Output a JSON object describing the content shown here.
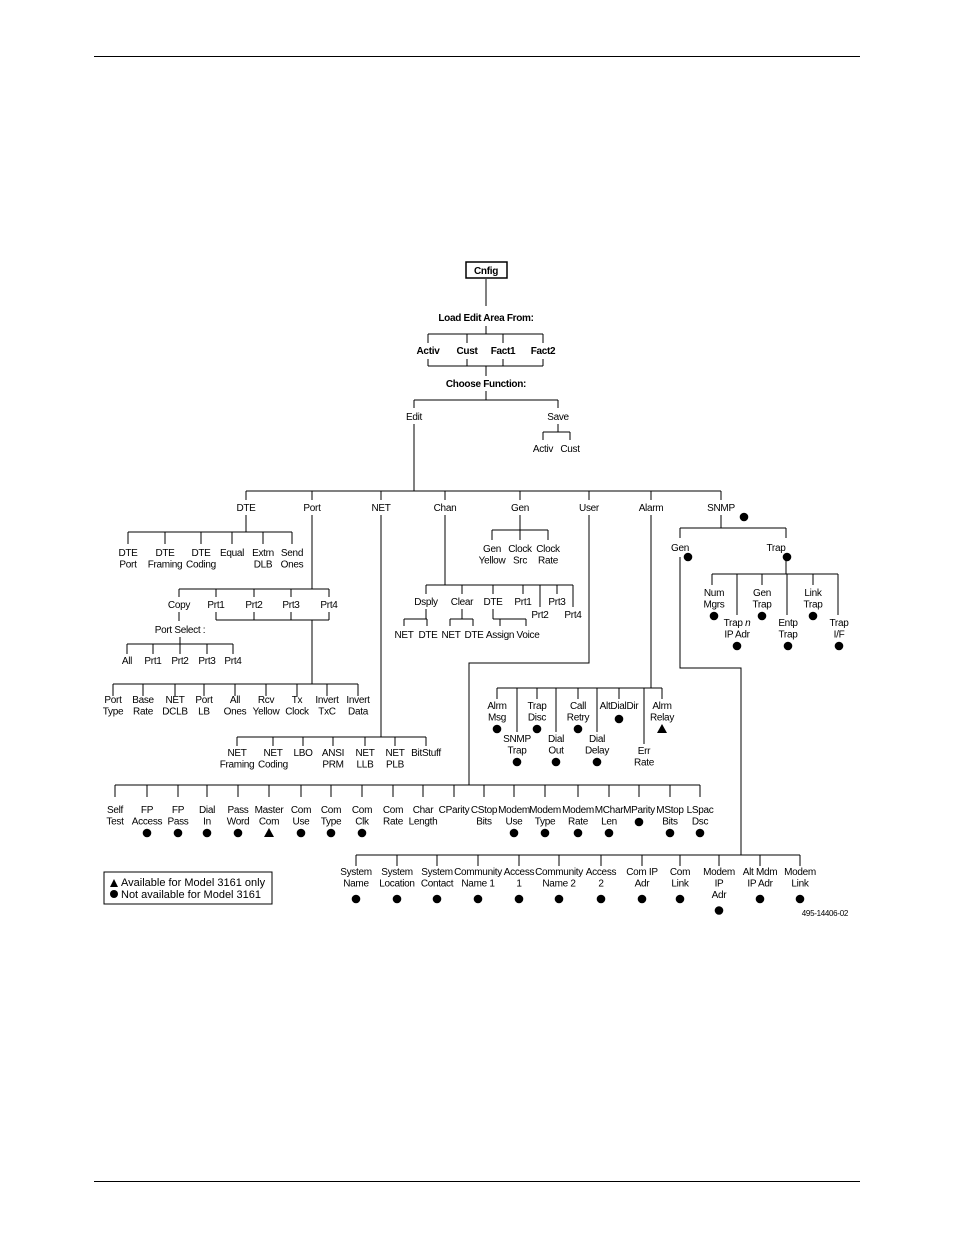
{
  "page": {
    "figure_id": "495-14406-02"
  },
  "legend": {
    "triangle": "Available for Model 3161 only",
    "circle": "Not available for Model 3161"
  },
  "tree": {
    "root": "Cnfig",
    "load_heading": "Load Edit Area From:",
    "load_options": [
      "Activ",
      "Cust",
      "Fact1",
      "Fact2"
    ],
    "function_heading": "Choose Function:",
    "functions": [
      "Edit",
      "Save"
    ],
    "save_options": [
      "Activ",
      "Cust"
    ],
    "edit_menu": [
      "DTE",
      "Port",
      "NET",
      "Chan",
      "Gen",
      "User",
      "Alarm",
      "SNMP"
    ],
    "dte": [
      [
        "DTE",
        "Port"
      ],
      [
        "DTE",
        "Framing"
      ],
      [
        "DTE",
        "Coding"
      ],
      [
        "Equal"
      ],
      [
        "Extrn",
        "DLB"
      ],
      [
        "Send",
        "Ones"
      ]
    ],
    "port_select_top": [
      "Copy",
      "Prt1",
      "Prt2",
      "Prt3",
      "Prt4"
    ],
    "port_select_heading": "Port Select :",
    "port_copy_options": [
      "All",
      "Prt1",
      "Prt2",
      "Prt3",
      "Prt4"
    ],
    "port_params": [
      [
        "Port",
        "Type"
      ],
      [
        "Base",
        "Rate"
      ],
      [
        "NET",
        "DCLB"
      ],
      [
        "Port",
        "LB"
      ],
      [
        "All",
        "Ones"
      ],
      [
        "Rcv",
        "Yellow"
      ],
      [
        "Tx",
        "Clock"
      ],
      [
        "Invert",
        "TxC"
      ],
      [
        "Invert",
        "Data"
      ]
    ],
    "net": [
      [
        "NET",
        "Framing"
      ],
      [
        "NET",
        "Coding"
      ],
      [
        "LBO"
      ],
      [
        "ANSI",
        "PRM"
      ],
      [
        "NET",
        "LLB"
      ],
      [
        "NET",
        "PLB"
      ],
      [
        "BitStuff"
      ]
    ],
    "chan": [
      "Dsply",
      "Clear",
      "DTE",
      "Prt1",
      "Prt2",
      "Prt3",
      "Prt4"
    ],
    "chan_dsply": [
      "NET",
      "DTE"
    ],
    "chan_clear": [
      "NET",
      "DTE"
    ],
    "chan_dte": [
      "Assign",
      "Voice"
    ],
    "gen": [
      [
        "Gen",
        "Yellow"
      ],
      [
        "Clock",
        "Src"
      ],
      [
        "Clock",
        "Rate"
      ]
    ],
    "user": [
      {
        "label": [
          "Self",
          "Test"
        ],
        "mark": ""
      },
      {
        "label": [
          "FP",
          "Access"
        ],
        "mark": "circle"
      },
      {
        "label": [
          "FP",
          "Pass"
        ],
        "mark": "circle"
      },
      {
        "label": [
          "Dial",
          "In"
        ],
        "mark": "circle"
      },
      {
        "label": [
          "Pass",
          "Word"
        ],
        "mark": "circle"
      },
      {
        "label": [
          "Master",
          "Com"
        ],
        "mark": "triangle"
      },
      {
        "label": [
          "Com",
          "Use"
        ],
        "mark": "circle"
      },
      {
        "label": [
          "Com",
          "Type"
        ],
        "mark": "circle"
      },
      {
        "label": [
          "Com",
          "Clk"
        ],
        "mark": "circle"
      },
      {
        "label": [
          "Com",
          "Rate"
        ],
        "mark": ""
      },
      {
        "label": [
          "Char",
          "Length"
        ],
        "mark": ""
      },
      {
        "label": [
          "CParity"
        ],
        "mark": ""
      },
      {
        "label": [
          "CStop",
          "Bits"
        ],
        "mark": ""
      },
      {
        "label": [
          "Modem",
          "Use"
        ],
        "mark": "circle"
      },
      {
        "label": [
          "Modem",
          "Type"
        ],
        "mark": "circle"
      },
      {
        "label": [
          "Modem",
          "Rate"
        ],
        "mark": "circle"
      },
      {
        "label": [
          "MChar",
          "Len"
        ],
        "mark": "circle"
      },
      {
        "label": [
          "MParity"
        ],
        "mark": "circle"
      },
      {
        "label": [
          "MStop",
          "Bits"
        ],
        "mark": "circle"
      },
      {
        "label": [
          "LSpac",
          "Dsc"
        ],
        "mark": "circle"
      }
    ],
    "alarm": [
      {
        "label": [
          "Alrm",
          "Msg"
        ],
        "mark": "circle"
      },
      {
        "label": [
          "SNMP",
          "Trap"
        ],
        "mark": "circle"
      },
      {
        "label": [
          "Trap",
          "Disc"
        ],
        "mark": "circle"
      },
      {
        "label": [
          "Dial",
          "Out"
        ],
        "mark": "circle"
      },
      {
        "label": [
          "Call",
          "Retry"
        ],
        "mark": "circle"
      },
      {
        "label": [
          "Dial",
          "Delay"
        ],
        "mark": "circle"
      },
      {
        "label": [
          "AltDialDir"
        ],
        "mark": "circle"
      },
      {
        "label": [
          "Err",
          "Rate"
        ],
        "mark": ""
      },
      {
        "label": [
          "Alrm",
          "Relay"
        ],
        "mark": "triangle"
      }
    ],
    "snmp_mark": "circle",
    "snmp": [
      {
        "label": "Gen",
        "mark": "circle"
      },
      {
        "label": "Trap",
        "mark": "circle"
      }
    ],
    "snmp_trap": [
      {
        "label": [
          "Num",
          "Mgrs"
        ],
        "mark": "circle"
      },
      {
        "label": [
          "Trap",
          "IP Adr"
        ],
        "mark": "circle",
        "italic_suffix": "n"
      },
      {
        "label": [
          "Gen",
          "Trap"
        ],
        "mark": "circle"
      },
      {
        "label": [
          "Entp",
          "Trap"
        ],
        "mark": "circle"
      },
      {
        "label": [
          "Link",
          "Trap"
        ],
        "mark": "circle"
      },
      {
        "label": [
          "Trap",
          "I/F"
        ],
        "mark": "circle"
      }
    ],
    "snmp_gen": [
      {
        "label": [
          "System",
          "Name"
        ],
        "mark": "circle"
      },
      {
        "label": [
          "System",
          "Location"
        ],
        "mark": "circle"
      },
      {
        "label": [
          "System",
          "Contact"
        ],
        "mark": "circle"
      },
      {
        "label": [
          "Community",
          "Name 1"
        ],
        "mark": "circle"
      },
      {
        "label": [
          "Access",
          "1"
        ],
        "mark": "circle"
      },
      {
        "label": [
          "Community",
          "Name 2"
        ],
        "mark": "circle"
      },
      {
        "label": [
          "Access",
          "2"
        ],
        "mark": "circle"
      },
      {
        "label": [
          "Com IP",
          "Adr"
        ],
        "mark": "circle"
      },
      {
        "label": [
          "Com",
          "Link"
        ],
        "mark": "circle"
      },
      {
        "label": [
          "Modem",
          "IP",
          "Adr"
        ],
        "mark": "circle"
      },
      {
        "label": [
          "Alt Mdm",
          "IP Adr"
        ],
        "mark": "circle"
      },
      {
        "label": [
          "Modem",
          "Link"
        ],
        "mark": "circle"
      }
    ]
  }
}
